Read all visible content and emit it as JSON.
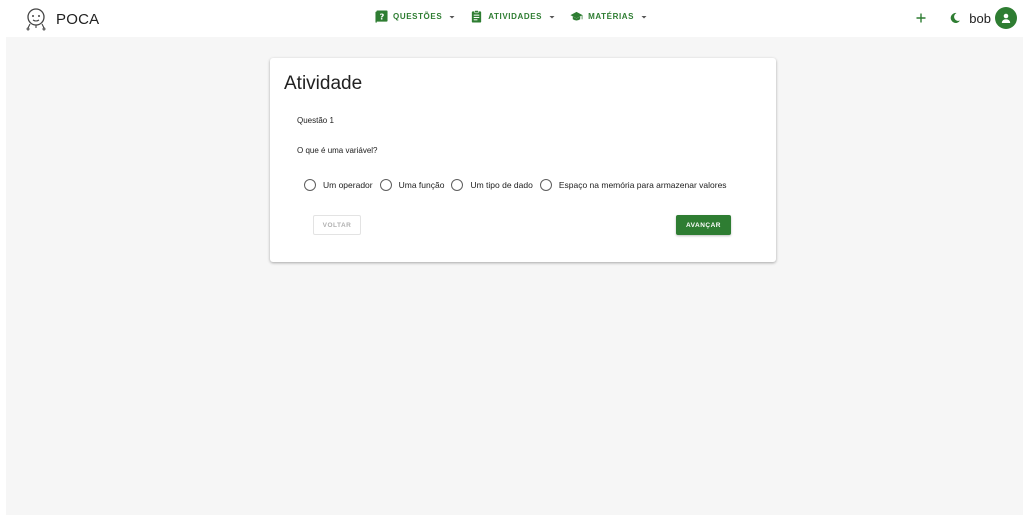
{
  "app": {
    "name": "POCA",
    "logo_icon": "robot-logo-icon"
  },
  "nav": {
    "items": [
      {
        "label": "QUESTÕES",
        "icon": "question-book-icon"
      },
      {
        "label": "ATIVIDADES",
        "icon": "clipboard-icon"
      },
      {
        "label": "MATÉRIAS",
        "icon": "graduation-cap-icon"
      }
    ]
  },
  "user": {
    "name": "bob",
    "avatar_icon": "person-icon"
  },
  "tools": {
    "add_icon": "plus-icon",
    "theme_icon": "moon-icon"
  },
  "card": {
    "title": "Atividade",
    "question_number": "Questão 1",
    "question_text": "O que é uma variável?",
    "options": [
      "Um operador",
      "Uma função",
      "Um tipo de dado",
      "Espaço na memória para armazenar valores"
    ],
    "back_label": "VOLTAR",
    "next_label": "AVANÇAR"
  },
  "colors": {
    "accent": "#2e7d32",
    "background": "#f6f6f6"
  }
}
